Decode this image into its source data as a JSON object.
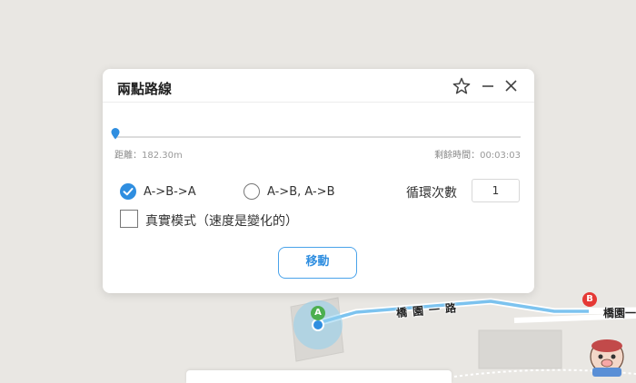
{
  "map": {
    "road_name_1": "橋園一路",
    "road_name_2": "橋園一",
    "pin_start_label": "A",
    "pin_end_label": "B",
    "colors": {
      "route": "#7cc3ef",
      "start_pin": "#4caf50",
      "end_pin": "#e53935",
      "user_dot": "#2f8ee0"
    }
  },
  "dialog": {
    "title": "兩點路線",
    "icons": [
      "star-icon",
      "minimize-icon",
      "close-icon"
    ],
    "progress": {
      "distance_label": "距離：",
      "distance_value": "182.30m",
      "remaining_label": "剩餘時間：",
      "remaining_value": "00:03:03",
      "position": 0
    },
    "options": {
      "option_1": "A->B->A",
      "option_2": "A->B, A->B",
      "selected": "A->B->A"
    },
    "loop": {
      "label": "循環次數",
      "value": "1"
    },
    "realistic_mode_label": "真實模式（速度是變化的）",
    "realistic_mode_checked": false,
    "move_button": "移動",
    "accent_color": "#2f8ee0"
  }
}
